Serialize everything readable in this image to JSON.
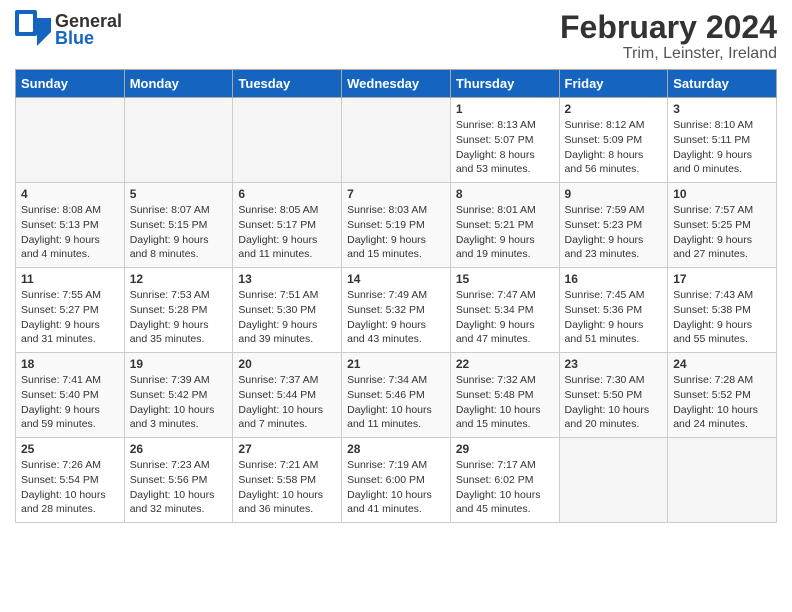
{
  "header": {
    "logo_line1": "General",
    "logo_line2": "Blue",
    "title": "February 2024",
    "subtitle": "Trim, Leinster, Ireland"
  },
  "weekdays": [
    "Sunday",
    "Monday",
    "Tuesday",
    "Wednesday",
    "Thursday",
    "Friday",
    "Saturday"
  ],
  "rows": [
    [
      {
        "day": "",
        "sunrise": "",
        "sunset": "",
        "daylight": "",
        "empty": true
      },
      {
        "day": "",
        "sunrise": "",
        "sunset": "",
        "daylight": "",
        "empty": true
      },
      {
        "day": "",
        "sunrise": "",
        "sunset": "",
        "daylight": "",
        "empty": true
      },
      {
        "day": "",
        "sunrise": "",
        "sunset": "",
        "daylight": "",
        "empty": true
      },
      {
        "day": "1",
        "sunrise": "Sunrise: 8:13 AM",
        "sunset": "Sunset: 5:07 PM",
        "daylight": "Daylight: 8 hours and 53 minutes."
      },
      {
        "day": "2",
        "sunrise": "Sunrise: 8:12 AM",
        "sunset": "Sunset: 5:09 PM",
        "daylight": "Daylight: 8 hours and 56 minutes."
      },
      {
        "day": "3",
        "sunrise": "Sunrise: 8:10 AM",
        "sunset": "Sunset: 5:11 PM",
        "daylight": "Daylight: 9 hours and 0 minutes."
      }
    ],
    [
      {
        "day": "4",
        "sunrise": "Sunrise: 8:08 AM",
        "sunset": "Sunset: 5:13 PM",
        "daylight": "Daylight: 9 hours and 4 minutes."
      },
      {
        "day": "5",
        "sunrise": "Sunrise: 8:07 AM",
        "sunset": "Sunset: 5:15 PM",
        "daylight": "Daylight: 9 hours and 8 minutes."
      },
      {
        "day": "6",
        "sunrise": "Sunrise: 8:05 AM",
        "sunset": "Sunset: 5:17 PM",
        "daylight": "Daylight: 9 hours and 11 minutes."
      },
      {
        "day": "7",
        "sunrise": "Sunrise: 8:03 AM",
        "sunset": "Sunset: 5:19 PM",
        "daylight": "Daylight: 9 hours and 15 minutes."
      },
      {
        "day": "8",
        "sunrise": "Sunrise: 8:01 AM",
        "sunset": "Sunset: 5:21 PM",
        "daylight": "Daylight: 9 hours and 19 minutes."
      },
      {
        "day": "9",
        "sunrise": "Sunrise: 7:59 AM",
        "sunset": "Sunset: 5:23 PM",
        "daylight": "Daylight: 9 hours and 23 minutes."
      },
      {
        "day": "10",
        "sunrise": "Sunrise: 7:57 AM",
        "sunset": "Sunset: 5:25 PM",
        "daylight": "Daylight: 9 hours and 27 minutes."
      }
    ],
    [
      {
        "day": "11",
        "sunrise": "Sunrise: 7:55 AM",
        "sunset": "Sunset: 5:27 PM",
        "daylight": "Daylight: 9 hours and 31 minutes."
      },
      {
        "day": "12",
        "sunrise": "Sunrise: 7:53 AM",
        "sunset": "Sunset: 5:28 PM",
        "daylight": "Daylight: 9 hours and 35 minutes."
      },
      {
        "day": "13",
        "sunrise": "Sunrise: 7:51 AM",
        "sunset": "Sunset: 5:30 PM",
        "daylight": "Daylight: 9 hours and 39 minutes."
      },
      {
        "day": "14",
        "sunrise": "Sunrise: 7:49 AM",
        "sunset": "Sunset: 5:32 PM",
        "daylight": "Daylight: 9 hours and 43 minutes."
      },
      {
        "day": "15",
        "sunrise": "Sunrise: 7:47 AM",
        "sunset": "Sunset: 5:34 PM",
        "daylight": "Daylight: 9 hours and 47 minutes."
      },
      {
        "day": "16",
        "sunrise": "Sunrise: 7:45 AM",
        "sunset": "Sunset: 5:36 PM",
        "daylight": "Daylight: 9 hours and 51 minutes."
      },
      {
        "day": "17",
        "sunrise": "Sunrise: 7:43 AM",
        "sunset": "Sunset: 5:38 PM",
        "daylight": "Daylight: 9 hours and 55 minutes."
      }
    ],
    [
      {
        "day": "18",
        "sunrise": "Sunrise: 7:41 AM",
        "sunset": "Sunset: 5:40 PM",
        "daylight": "Daylight: 9 hours and 59 minutes."
      },
      {
        "day": "19",
        "sunrise": "Sunrise: 7:39 AM",
        "sunset": "Sunset: 5:42 PM",
        "daylight": "Daylight: 10 hours and 3 minutes."
      },
      {
        "day": "20",
        "sunrise": "Sunrise: 7:37 AM",
        "sunset": "Sunset: 5:44 PM",
        "daylight": "Daylight: 10 hours and 7 minutes."
      },
      {
        "day": "21",
        "sunrise": "Sunrise: 7:34 AM",
        "sunset": "Sunset: 5:46 PM",
        "daylight": "Daylight: 10 hours and 11 minutes."
      },
      {
        "day": "22",
        "sunrise": "Sunrise: 7:32 AM",
        "sunset": "Sunset: 5:48 PM",
        "daylight": "Daylight: 10 hours and 15 minutes."
      },
      {
        "day": "23",
        "sunrise": "Sunrise: 7:30 AM",
        "sunset": "Sunset: 5:50 PM",
        "daylight": "Daylight: 10 hours and 20 minutes."
      },
      {
        "day": "24",
        "sunrise": "Sunrise: 7:28 AM",
        "sunset": "Sunset: 5:52 PM",
        "daylight": "Daylight: 10 hours and 24 minutes."
      }
    ],
    [
      {
        "day": "25",
        "sunrise": "Sunrise: 7:26 AM",
        "sunset": "Sunset: 5:54 PM",
        "daylight": "Daylight: 10 hours and 28 minutes."
      },
      {
        "day": "26",
        "sunrise": "Sunrise: 7:23 AM",
        "sunset": "Sunset: 5:56 PM",
        "daylight": "Daylight: 10 hours and 32 minutes."
      },
      {
        "day": "27",
        "sunrise": "Sunrise: 7:21 AM",
        "sunset": "Sunset: 5:58 PM",
        "daylight": "Daylight: 10 hours and 36 minutes."
      },
      {
        "day": "28",
        "sunrise": "Sunrise: 7:19 AM",
        "sunset": "Sunset: 6:00 PM",
        "daylight": "Daylight: 10 hours and 41 minutes."
      },
      {
        "day": "29",
        "sunrise": "Sunrise: 7:17 AM",
        "sunset": "Sunset: 6:02 PM",
        "daylight": "Daylight: 10 hours and 45 minutes."
      },
      {
        "day": "",
        "sunrise": "",
        "sunset": "",
        "daylight": "",
        "empty": true
      },
      {
        "day": "",
        "sunrise": "",
        "sunset": "",
        "daylight": "",
        "empty": true
      }
    ]
  ]
}
